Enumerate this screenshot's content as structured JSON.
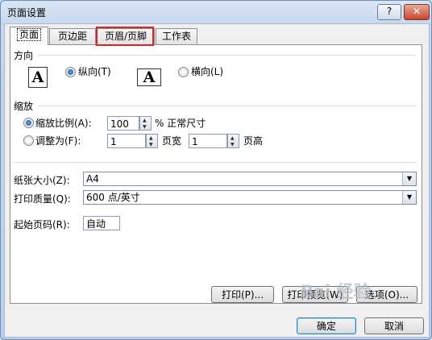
{
  "window": {
    "title": "页面设置",
    "help": "?",
    "close": "✕"
  },
  "tabs": [
    {
      "label": "页面",
      "active": true
    },
    {
      "label": "页边距"
    },
    {
      "label": "页眉/页脚",
      "highlighted": true
    },
    {
      "label": "工作表"
    }
  ],
  "orientation": {
    "section": "方向",
    "portrait_label": "纵向(T)",
    "landscape_label": "横向(L)",
    "paper_glyph": "A",
    "selected": "portrait"
  },
  "scaling": {
    "section": "缩放",
    "scale_label": "缩放比例(A):",
    "scale_value": "100",
    "scale_suffix": "% 正常尺寸",
    "fit_label": "调整为(F):",
    "fit_wide_value": "1",
    "fit_wide_label": "页宽",
    "fit_tall_value": "1",
    "fit_tall_label": "页高",
    "selected": "scale"
  },
  "paper": {
    "size_label": "纸张大小(Z):",
    "size_value": "A4",
    "quality_label": "打印质量(Q):",
    "quality_value": "600 点/英寸"
  },
  "first_page": {
    "label": "起始页码(R):",
    "value": "自动"
  },
  "actions": {
    "print": "打印(P)...",
    "preview": "打印预览(W)",
    "options": "选项(O)..."
  },
  "footer": {
    "ok": "确定",
    "cancel": "取消"
  },
  "watermark": "Bai 经验",
  "colors": {
    "highlight": "#d8242b",
    "radio_on": "#1a4e9c"
  }
}
